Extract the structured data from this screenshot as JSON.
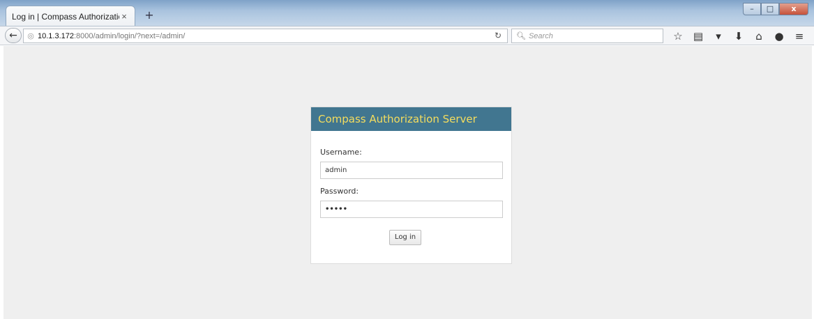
{
  "browser": {
    "tab_title": "Log in | Compass Authorizatio...",
    "tab_close": "×",
    "new_tab": "+",
    "url_host": "10.1.3.172",
    "url_rest": ":8000/admin/login/?next=/admin/",
    "search_placeholder": "Search",
    "window_controls": [
      "–",
      "□",
      "x"
    ],
    "toolbar_icons": [
      "star-icon",
      "bookmarks-icon",
      "pocket-icon",
      "download-icon",
      "home-icon",
      "chat-icon",
      "menu-icon"
    ]
  },
  "login": {
    "title": "Compass Authorization Server",
    "username_label": "Username:",
    "username_value": "admin",
    "password_label": "Password:",
    "password_value": "•••••",
    "submit_label": "Log in"
  },
  "colors": {
    "header_bg": "#417690",
    "header_text": "#f5dd5d",
    "page_bg": "#efefef"
  }
}
